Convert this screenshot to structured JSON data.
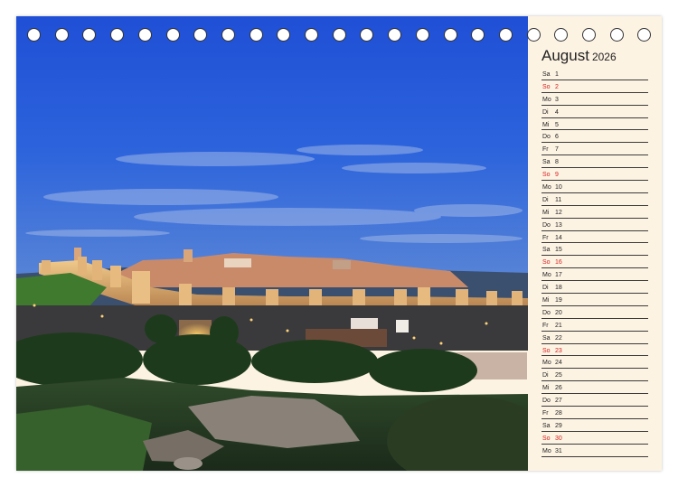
{
  "calendar": {
    "month": "August",
    "year": "2026",
    "sunday_color": "#d62020",
    "days": [
      {
        "dow": "Sa",
        "day": "1"
      },
      {
        "dow": "So",
        "day": "2"
      },
      {
        "dow": "Mo",
        "day": "3"
      },
      {
        "dow": "Di",
        "day": "4"
      },
      {
        "dow": "Mi",
        "day": "5"
      },
      {
        "dow": "Do",
        "day": "6"
      },
      {
        "dow": "Fr",
        "day": "7"
      },
      {
        "dow": "Sa",
        "day": "8"
      },
      {
        "dow": "So",
        "day": "9"
      },
      {
        "dow": "Mo",
        "day": "10"
      },
      {
        "dow": "Di",
        "day": "11"
      },
      {
        "dow": "Mi",
        "day": "12"
      },
      {
        "dow": "Do",
        "day": "13"
      },
      {
        "dow": "Fr",
        "day": "14"
      },
      {
        "dow": "Sa",
        "day": "15"
      },
      {
        "dow": "So",
        "day": "16"
      },
      {
        "dow": "Mo",
        "day": "17"
      },
      {
        "dow": "Di",
        "day": "18"
      },
      {
        "dow": "Mi",
        "day": "19"
      },
      {
        "dow": "Do",
        "day": "20"
      },
      {
        "dow": "Fr",
        "day": "21"
      },
      {
        "dow": "Sa",
        "day": "22"
      },
      {
        "dow": "So",
        "day": "23"
      },
      {
        "dow": "Mo",
        "day": "24"
      },
      {
        "dow": "Di",
        "day": "25"
      },
      {
        "dow": "Mi",
        "day": "26"
      },
      {
        "dow": "Do",
        "day": "27"
      },
      {
        "dow": "Fr",
        "day": "28"
      },
      {
        "dow": "Sa",
        "day": "29"
      },
      {
        "dow": "So",
        "day": "30"
      },
      {
        "dow": "Mo",
        "day": "31"
      }
    ]
  },
  "binding": {
    "ring_count": 23
  }
}
